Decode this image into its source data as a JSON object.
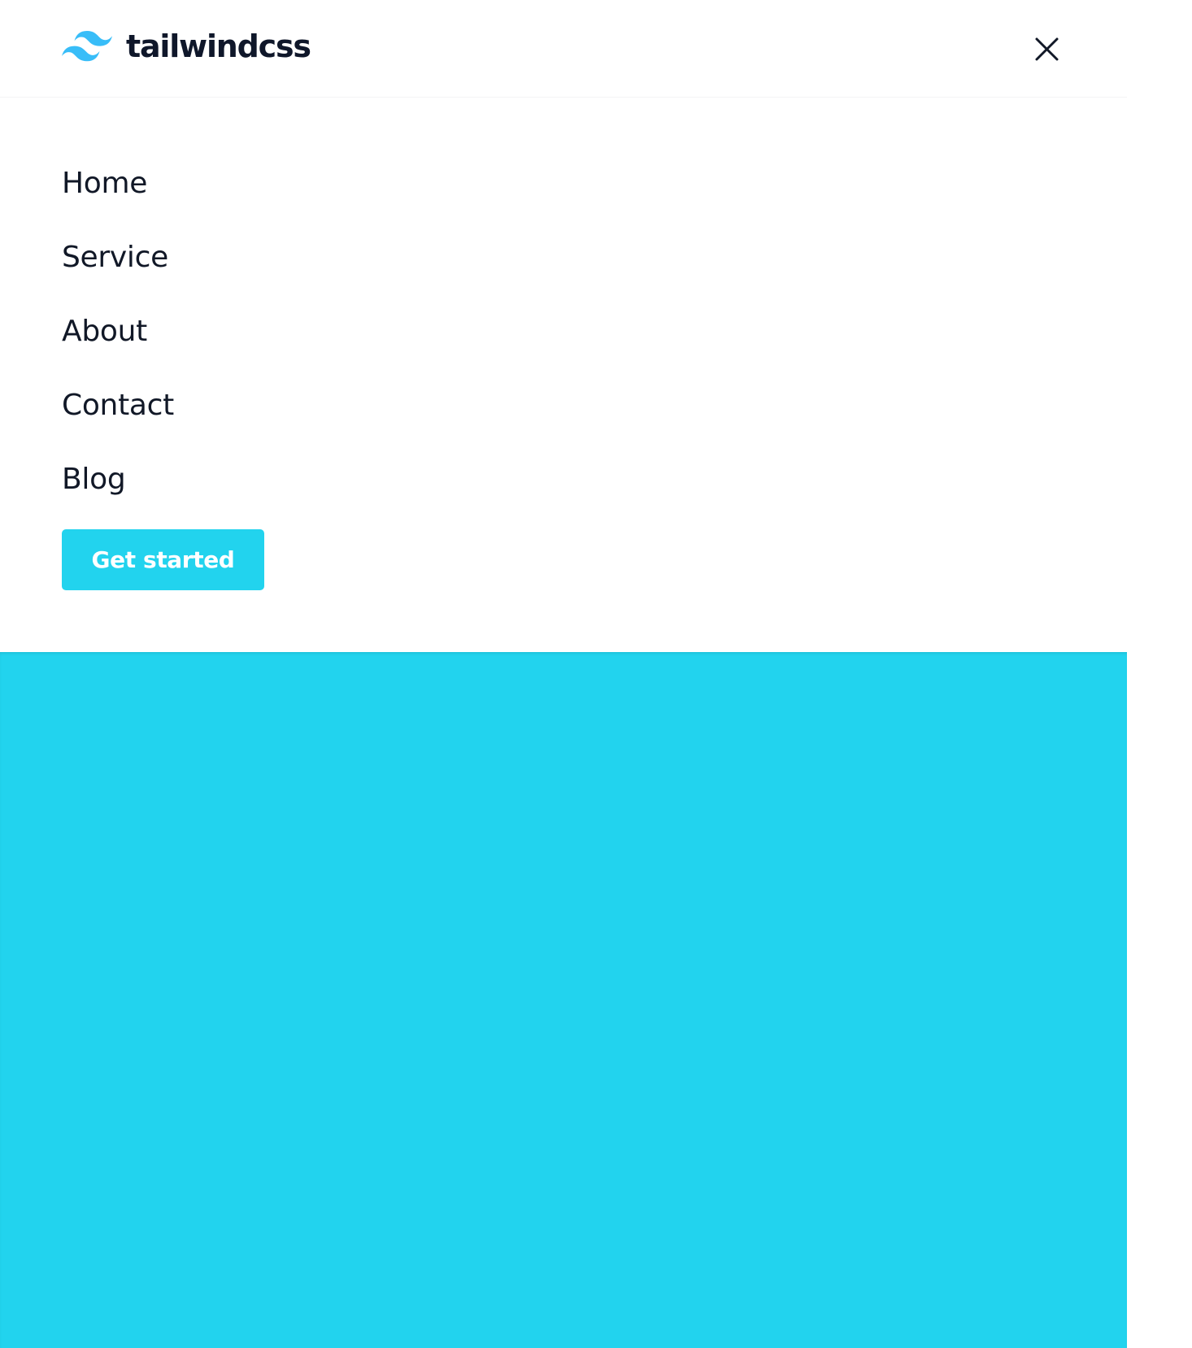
{
  "header": {
    "logo_text": "tailwindcss",
    "logo_icon": "tailwind-wave-icon",
    "close_icon": "close-icon"
  },
  "menu": {
    "items": [
      {
        "label": "Home"
      },
      {
        "label": "Service"
      },
      {
        "label": "About"
      },
      {
        "label": "Contact"
      },
      {
        "label": "Blog"
      }
    ],
    "cta_label": "Get started"
  },
  "colors": {
    "brand_cyan": "#22d3ee",
    "logo_blue": "#38bdf8",
    "text_dark": "#0f172a"
  }
}
